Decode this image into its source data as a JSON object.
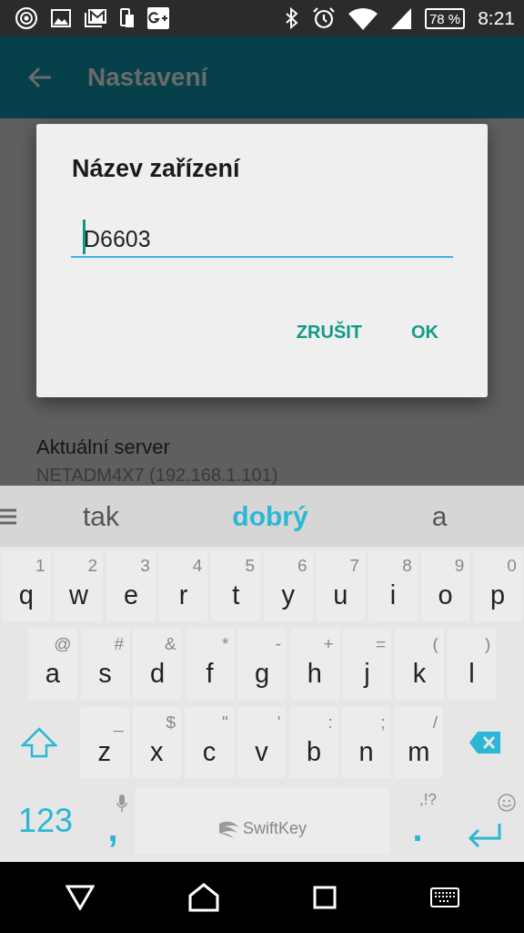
{
  "status_bar": {
    "battery": "78 %",
    "time": "8:21"
  },
  "app_bar": {
    "title": "Nastavení"
  },
  "settings": [
    {
      "title": "Aktuální server",
      "subtitle": "NETADM4X7 (192.168.1.101)"
    }
  ],
  "dialog": {
    "title": "Název zařízení",
    "field": {
      "value": "D6603",
      "focused": true
    },
    "buttons": [
      "ZRUŠIT",
      "OK"
    ]
  },
  "keyboard": {
    "suggestions": [
      {
        "text": "tak",
        "selected": false
      },
      {
        "text": "dobrý",
        "selected": true
      },
      {
        "text": "a",
        "selected": false
      }
    ],
    "rows": [
      [
        {
          "label": "q",
          "hint": "1"
        },
        {
          "label": "w",
          "hint": "2"
        },
        {
          "label": "e",
          "hint": "3"
        },
        {
          "label": "r",
          "hint": "4"
        },
        {
          "label": "t",
          "hint": "5"
        },
        {
          "label": "y",
          "hint": "6"
        },
        {
          "label": "u",
          "hint": "7"
        },
        {
          "label": "i",
          "hint": "8"
        },
        {
          "label": "o",
          "hint": "9"
        },
        {
          "label": "p",
          "hint": "0"
        }
      ],
      [
        {
          "label": "a",
          "hint": "@"
        },
        {
          "label": "s",
          "hint": "#"
        },
        {
          "label": "d",
          "hint": "&"
        },
        {
          "label": "f",
          "hint": "*"
        },
        {
          "label": "g",
          "hint": "-"
        },
        {
          "label": "h",
          "hint": "+"
        },
        {
          "label": "j",
          "hint": "="
        },
        {
          "label": "k",
          "hint": "("
        },
        {
          "label": "l",
          "hint": ")"
        }
      ],
      [
        {
          "label": "z",
          "hint": "_"
        },
        {
          "label": "x",
          "hint": "$"
        },
        {
          "label": "c",
          "hint": "\""
        },
        {
          "label": "v",
          "hint": "'"
        },
        {
          "label": "b",
          "hint": ":"
        },
        {
          "label": "n",
          "hint": ";"
        },
        {
          "label": "m",
          "hint": "/"
        }
      ]
    ],
    "numbers_key": "123",
    "comma_key": ",",
    "space_brand": "SwiftKey",
    "punctuation_hint": ",!?",
    "period_key": "."
  }
}
